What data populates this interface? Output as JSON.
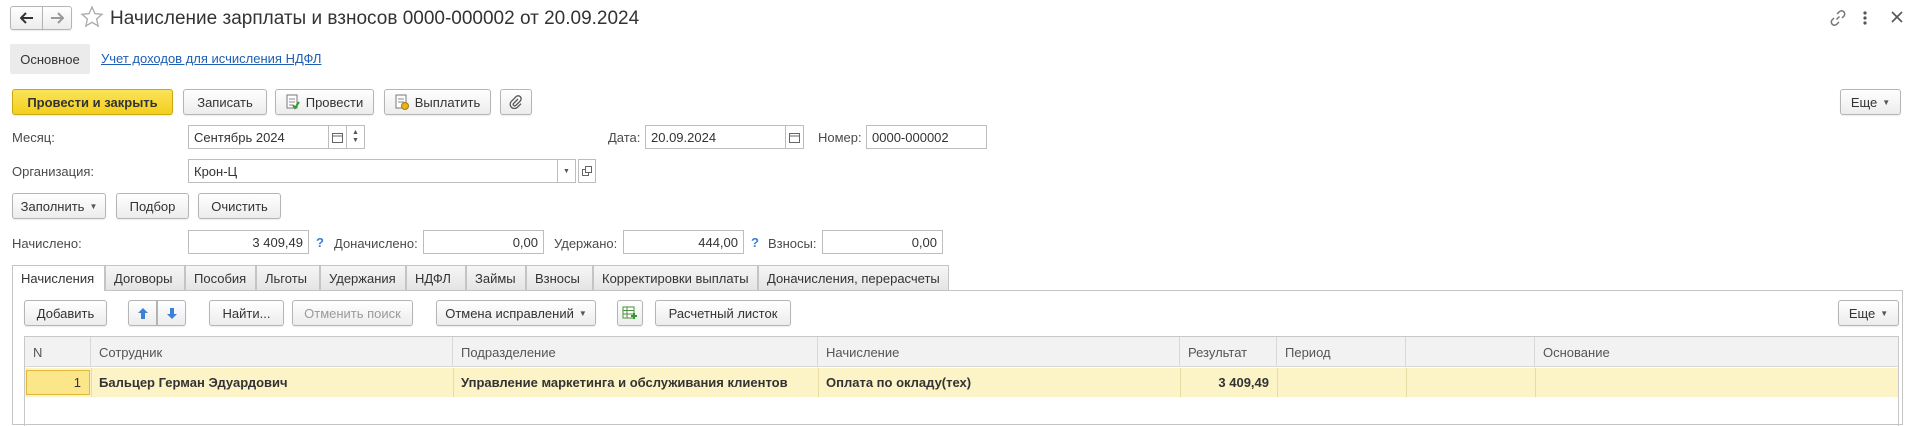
{
  "window": {
    "title": "Начисление зарплаты и взносов 0000-000002 от 20.09.2024"
  },
  "nav": {
    "main_label": "Основное",
    "link_ndfl": "Учет доходов для исчисления НДФЛ"
  },
  "toolbar": {
    "post_close": "Провести и закрыть",
    "save": "Записать",
    "post": "Провести",
    "pay": "Выплатить",
    "more": "Еще"
  },
  "form": {
    "month_label": "Месяц:",
    "month_value": "Сентябрь 2024",
    "date_label": "Дата:",
    "date_value": "20.09.2024",
    "number_label": "Номер:",
    "number_value": "0000-000002",
    "org_label": "Организация:",
    "org_value": "Крон-Ц"
  },
  "actions": {
    "fill": "Заполнить",
    "pick": "Подбор",
    "clear": "Очистить"
  },
  "totals": {
    "accrued_label": "Начислено:",
    "accrued_value": "3 409,49",
    "additional_label": "Доначислено:",
    "additional_value": "0,00",
    "withheld_label": "Удержано:",
    "withheld_value": "444,00",
    "contrib_label": "Взносы:",
    "contrib_value": "0,00",
    "help_mark": "?"
  },
  "tabs": [
    "Начисления",
    "Договоры",
    "Пособия",
    "Льготы",
    "Удержания",
    "НДФЛ",
    "Займы",
    "Взносы",
    "Корректировки выплаты",
    "Доначисления, перерасчеты"
  ],
  "table_toolbar": {
    "add": "Добавить",
    "find": "Найти...",
    "cancel_search": "Отменить поиск",
    "cancel_fix": "Отмена исправлений",
    "payslip": "Расчетный листок",
    "more": "Еще"
  },
  "table": {
    "columns": [
      "N",
      "Сотрудник",
      "Подразделение",
      "Начисление",
      "Результат",
      "Период",
      "",
      "Основание"
    ],
    "rows": [
      {
        "n": "1",
        "employee": "Бальцер Герман Эдуардович",
        "department": "Управление маркетинга и обслуживания клиентов",
        "accrual": "Оплата по окладу(тех)",
        "result": "3 409,49",
        "period": "",
        "extra": "",
        "basis": ""
      }
    ]
  },
  "colors": {
    "primary_button": "#f3cf1c",
    "selected_row": "#fcf3c6",
    "link": "#1e5fb4",
    "help": "#3b7fd6"
  }
}
